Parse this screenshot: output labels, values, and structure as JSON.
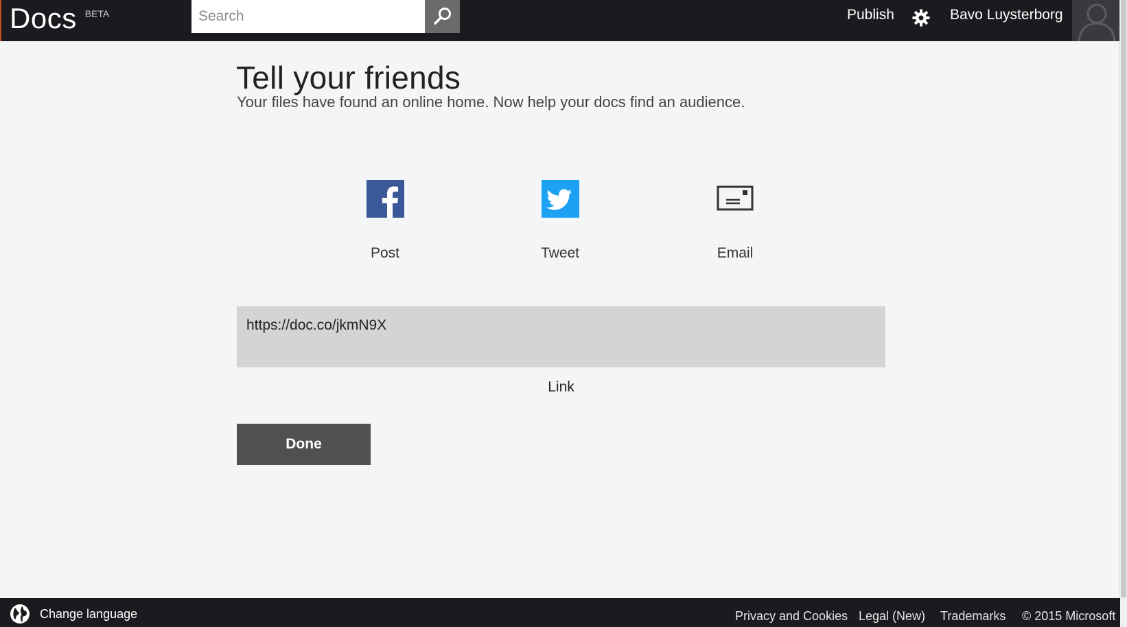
{
  "header": {
    "logo": "Docs",
    "beta_badge": "BETA",
    "search_placeholder": "Search",
    "publish_label": "Publish",
    "user_name": "Bavo Luysterborg",
    "icons": {
      "search": "search-icon",
      "settings": "gear-icon",
      "avatar": "avatar-silhouette"
    }
  },
  "main": {
    "title": "Tell your friends",
    "subtitle": "Your files have found an online home. Now help your docs find an audience.",
    "share_options": [
      {
        "label": "Post",
        "icon": "facebook-icon",
        "color": "#3b5998"
      },
      {
        "label": "Tweet",
        "icon": "twitter-icon",
        "color": "#1da1f2"
      },
      {
        "label": "Email",
        "icon": "email-icon",
        "color": "#333333"
      }
    ],
    "link_value": "https://doc.co/jkmN9X",
    "link_caption": "Link",
    "done_label": "Done"
  },
  "footer": {
    "change_language": "Change language",
    "links": [
      "Privacy and Cookies",
      "Legal (New)",
      "Trademarks",
      "© 2015 Microsoft"
    ]
  }
}
